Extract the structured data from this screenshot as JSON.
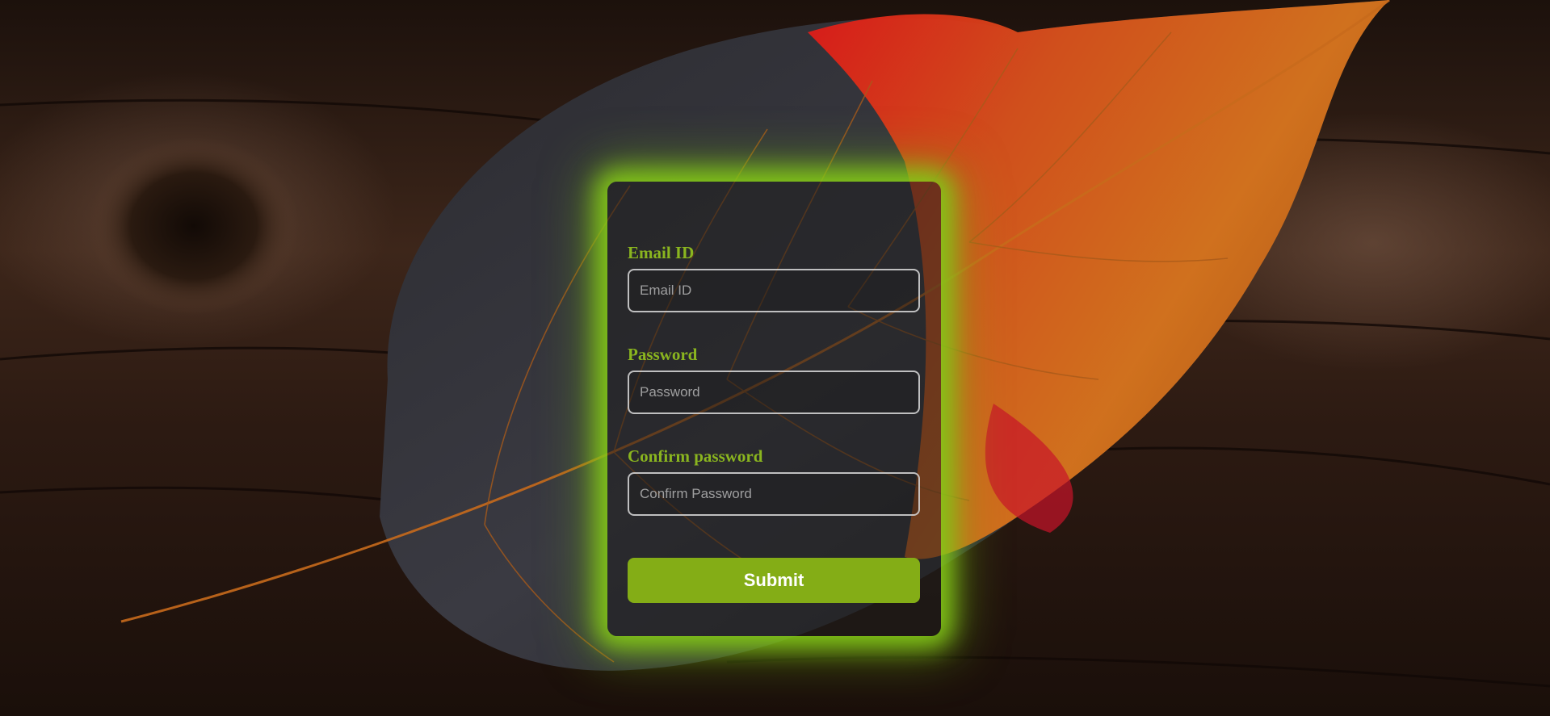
{
  "form": {
    "email": {
      "label": "Email ID",
      "placeholder": "Email ID",
      "value": ""
    },
    "password": {
      "label": "Password",
      "placeholder": "Password",
      "value": ""
    },
    "confirm_password": {
      "label": "Confirm password",
      "placeholder": "Confirm Password",
      "value": ""
    },
    "submit_label": "Submit"
  },
  "colors": {
    "accent": "#84ad16",
    "label": "#8ab51f",
    "glow": "#84c818",
    "wood": "#3a2418"
  },
  "background": {
    "subject": "autumn-leaf-on-wood"
  }
}
